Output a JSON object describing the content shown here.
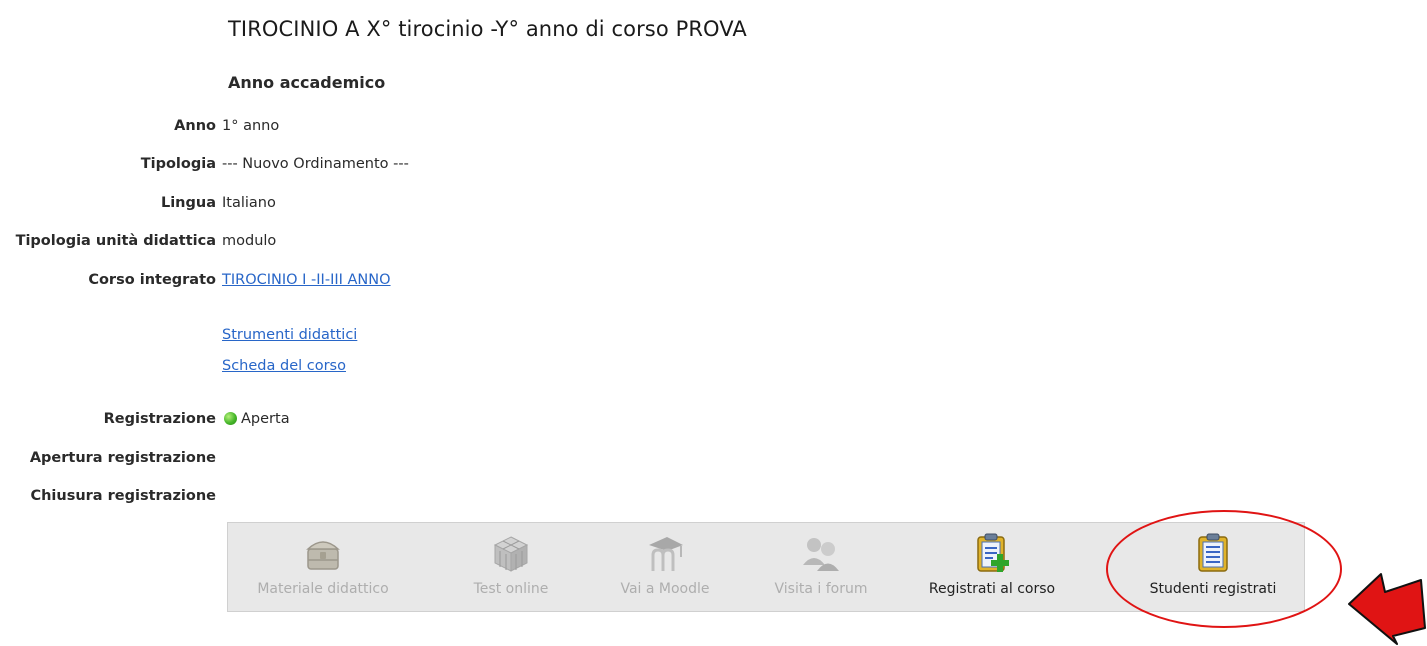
{
  "page": {
    "title": "TIROCINIO A X° tirocinio -Y° anno di corso PROVA",
    "section_title": "Anno accademico"
  },
  "fields": {
    "anno": {
      "label": "Anno",
      "value": "1° anno"
    },
    "tipologia": {
      "label": "Tipologia",
      "value": "--- Nuovo Ordinamento ---"
    },
    "lingua": {
      "label": "Lingua",
      "value": "Italiano"
    },
    "tipologia_unita": {
      "label": "Tipologia unità didattica",
      "value": "modulo"
    },
    "corso_integrato": {
      "label": "Corso integrato",
      "value": "TIROCINIO I -II-III ANNO"
    },
    "registrazione": {
      "label": "Registrazione",
      "value": "Aperta",
      "status_color": "#3aa820"
    },
    "apertura": {
      "label": "Apertura registrazione"
    },
    "chiusura": {
      "label": "Chiusura registrazione"
    }
  },
  "links": {
    "strumenti": "Strumenti didattici",
    "scheda": "Scheda del corso"
  },
  "toolbar": {
    "items": [
      {
        "label": "Materiale didattico",
        "icon": "treasure-chest-icon",
        "enabled": false
      },
      {
        "label": "Test online",
        "icon": "rubiks-cube-icon",
        "enabled": false
      },
      {
        "label": "Vai a Moodle",
        "icon": "moodle-icon",
        "enabled": false
      },
      {
        "label": "Visita i forum",
        "icon": "forum-users-icon",
        "enabled": false
      },
      {
        "label": "Registrati al corso",
        "icon": "clipboard-add-icon",
        "enabled": true
      },
      {
        "label": "Studenti registrati",
        "icon": "clipboard-list-icon",
        "enabled": true
      }
    ]
  },
  "colors": {
    "link": "#2866c8",
    "annotation": "#e01414",
    "toolbar_bg": "#e8e8e8"
  }
}
